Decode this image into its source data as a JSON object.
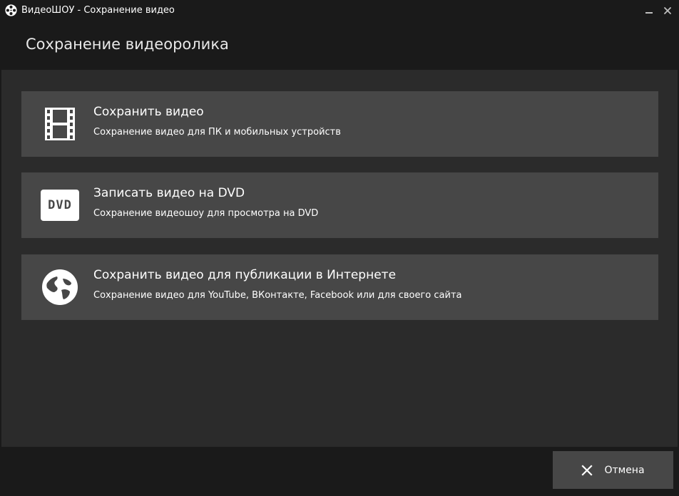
{
  "window": {
    "title": "ВидеоШОУ - Сохранение видео",
    "app_icon": "film-reel-icon"
  },
  "header": {
    "title": "Сохранение видеоролика"
  },
  "options": [
    {
      "icon": "film-strip-icon",
      "title": "Сохранить видео",
      "description": "Сохранение видео для ПК и мобильных устройств"
    },
    {
      "icon": "dvd-icon",
      "icon_text": "DVD",
      "title": "Записать видео на DVD",
      "description": "Сохранение видеошоу для просмотра на DVD"
    },
    {
      "icon": "globe-icon",
      "title": "Сохранить видео для публикации в Интернете",
      "description": "Сохранение видео для YouTube, ВКонтакте, Facebook или для своего сайта"
    }
  ],
  "footer": {
    "cancel_label": "Отмена"
  },
  "colors": {
    "window_bg": "#1a1a1a",
    "content_bg": "#2b2b2b",
    "option_bg": "#474747",
    "text": "#ffffff"
  }
}
